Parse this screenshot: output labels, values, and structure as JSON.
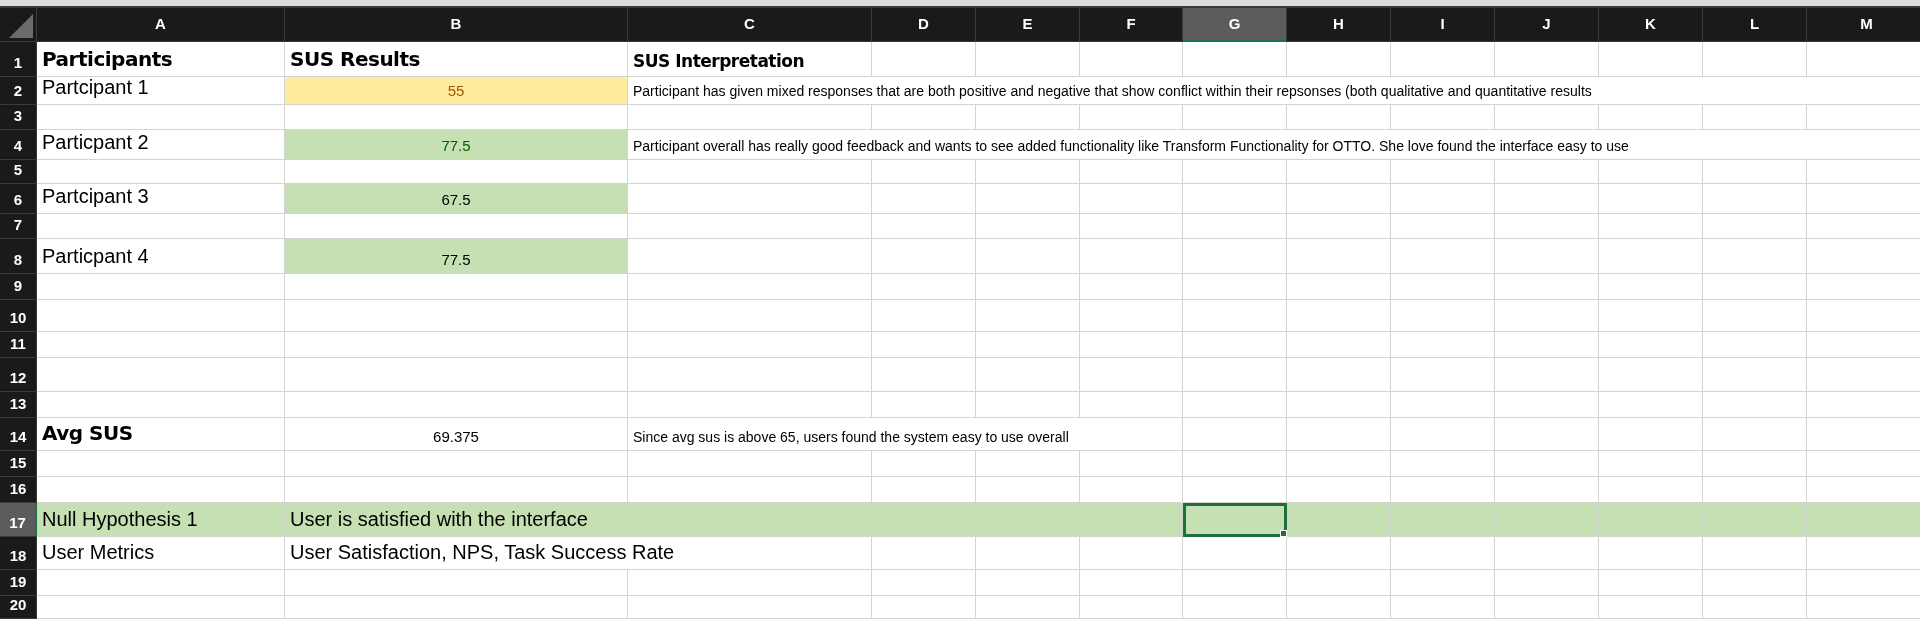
{
  "columns": [
    {
      "label": "A",
      "selected": false
    },
    {
      "label": "B",
      "selected": false
    },
    {
      "label": "C",
      "selected": false
    },
    {
      "label": "D",
      "selected": false
    },
    {
      "label": "E",
      "selected": false
    },
    {
      "label": "F",
      "selected": false
    },
    {
      "label": "G",
      "selected": true
    },
    {
      "label": "H",
      "selected": false
    },
    {
      "label": "I",
      "selected": false
    },
    {
      "label": "J",
      "selected": false
    },
    {
      "label": "K",
      "selected": false
    },
    {
      "label": "L",
      "selected": false
    },
    {
      "label": "M",
      "selected": false
    }
  ],
  "rows": [
    {
      "number": "1",
      "selected": false,
      "highlighted": false,
      "cells": [
        {
          "text": "Participants",
          "kind": "heading",
          "selected": false
        },
        {
          "text": "SUS Results",
          "kind": "heading",
          "selected": false
        },
        {
          "text": "SUS Interpretation",
          "kind": "subheading",
          "selected": false
        }
      ]
    },
    {
      "number": "2",
      "selected": false,
      "highlighted": false,
      "cells": [
        {
          "text": "Partcipant 1",
          "kind": "name",
          "selected": false
        },
        {
          "text": "55",
          "kind": "warning",
          "selected": false
        },
        {
          "text": "Participant has given mixed responses that are both positive and negative that show conflict within their repsonses (both qualitative and quantitative results",
          "kind": "note",
          "selected": false
        }
      ]
    },
    {
      "number": "3",
      "selected": false,
      "highlighted": false
    },
    {
      "number": "4",
      "selected": false,
      "highlighted": false,
      "cells": [
        {
          "text": "Particpant 2",
          "kind": "name",
          "selected": false
        },
        {
          "text": "77.5",
          "kind": "good",
          "selected": false
        },
        {
          "text": "Participant overall has really good feedback and wants to see added functionality like Transform Functionality for OTTO. She love found the interface easy to use",
          "kind": "note",
          "selected": false
        }
      ]
    },
    {
      "number": "5",
      "selected": false,
      "highlighted": false
    },
    {
      "number": "6",
      "selected": false,
      "highlighted": false,
      "cells": [
        {
          "text": "Partcipant 3",
          "kind": "name",
          "selected": false
        },
        {
          "text": "67.5",
          "kind": "shaded",
          "selected": false
        }
      ]
    },
    {
      "number": "7",
      "selected": false,
      "highlighted": false
    },
    {
      "number": "8",
      "selected": false,
      "highlighted": false,
      "cells": [
        {
          "text": "Particpant 4",
          "kind": "name",
          "selected": false
        },
        {
          "text": "77.5",
          "kind": "shaded",
          "selected": false
        }
      ]
    },
    {
      "number": "9",
      "selected": false,
      "highlighted": false
    },
    {
      "number": "10",
      "selected": false,
      "highlighted": false
    },
    {
      "number": "11",
      "selected": false,
      "highlighted": false
    },
    {
      "number": "12",
      "selected": false,
      "highlighted": false
    },
    {
      "number": "13",
      "selected": false,
      "highlighted": false
    },
    {
      "number": "14",
      "selected": false,
      "highlighted": false,
      "cells": [
        {
          "text": "Avg SUS",
          "kind": "heading",
          "selected": false
        },
        {
          "text": "69.375",
          "kind": "score",
          "selected": false
        },
        {
          "text": "Since avg sus is above 65, users found the system easy to use overall",
          "kind": "note",
          "selected": false
        }
      ]
    },
    {
      "number": "15",
      "selected": false,
      "highlighted": false
    },
    {
      "number": "16",
      "selected": false,
      "highlighted": false
    },
    {
      "number": "17",
      "selected": true,
      "highlighted": true,
      "cells": [
        {
          "text": "Null Hypothesis 1",
          "kind": "statement",
          "selected": false
        },
        {
          "text": "User is satisfied with the interface",
          "kind": "statement",
          "selected": false
        },
        {
          "selected": false
        },
        {
          "selected": false
        },
        {
          "selected": false
        },
        {
          "selected": false
        },
        {
          "selected": true
        }
      ]
    },
    {
      "number": "18",
      "selected": false,
      "highlighted": false,
      "cells": [
        {
          "text": "User Metrics",
          "kind": "statement",
          "selected": false
        },
        {
          "text": "User Satisfaction, NPS, Task Success Rate",
          "kind": "statement",
          "selected": false
        }
      ]
    },
    {
      "number": "19",
      "selected": false,
      "highlighted": false
    },
    {
      "number": "20",
      "selected": false,
      "highlighted": false
    }
  ]
}
